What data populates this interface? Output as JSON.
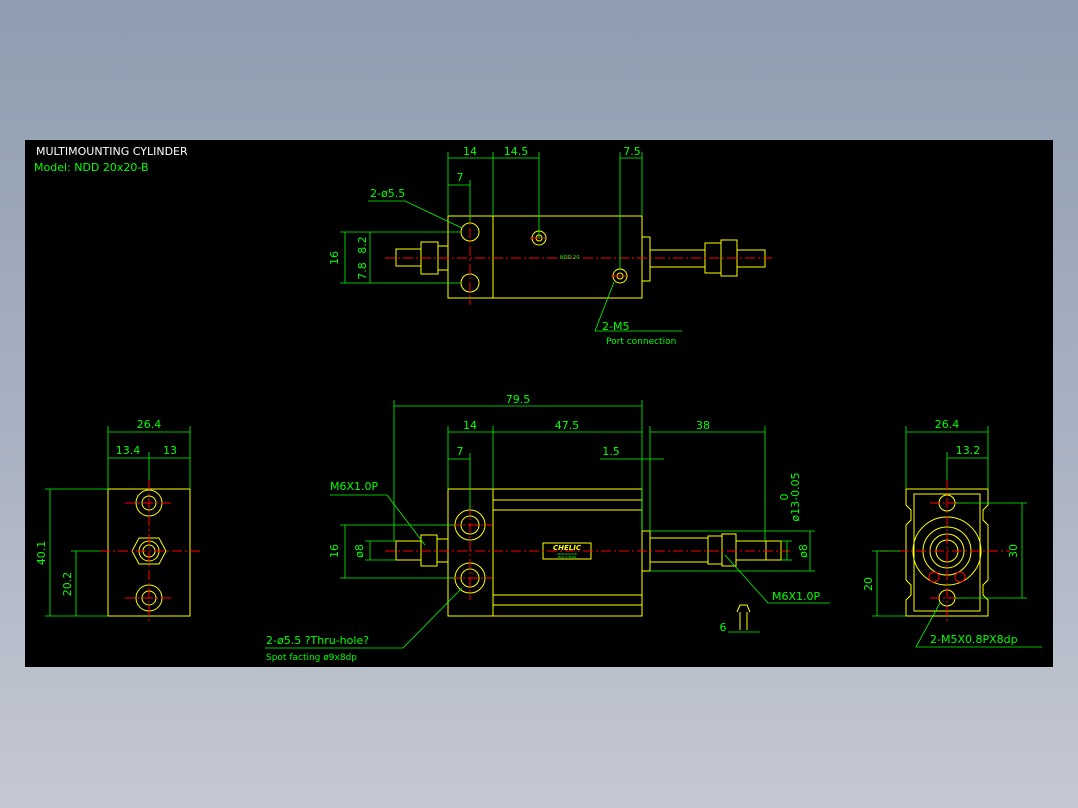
{
  "drawing": {
    "title": "MULTIMOUNTING CYLINDER",
    "model": "Model:  NDD 20x20-B",
    "colors": {
      "background": "#000000",
      "outline": "#ffff00",
      "dimension": "#00ff00",
      "centerline": "#ff0000",
      "title_text": "#ffffff",
      "model_text": "#00ff00",
      "desktop": "#9aa6b8"
    }
  },
  "top_view": {
    "dims": {
      "d14": "14",
      "d14_5": "14.5",
      "d7_5": "7.5",
      "d7": "7",
      "d16": "16",
      "d7_8": "7.8",
      "d8_2": "8.2"
    },
    "callouts": {
      "holes": "2-ø5.5",
      "ports": "2-M5",
      "ports_note": "Port connection",
      "nameplate": "NDD 20"
    }
  },
  "front_view": {
    "dims": {
      "overall": "79.5",
      "d14": "14",
      "d47_5": "47.5",
      "d38": "38",
      "d7": "7",
      "d1_5": "1.5",
      "d16": "16",
      "dia8_left": "ø8",
      "dia8_right": "ø8",
      "rod_dia": "ø13-0.05",
      "rod_tol": "0",
      "wrench": "6"
    },
    "callouts": {
      "thread_left": "M6X1.0P",
      "thread_right": "M6X1.0P",
      "holes": "2-ø5.5 ?Thru-hole?",
      "spot": "Spot facting   ø9x8dp",
      "brand": "CHELIC",
      "label_line1": "NDD20X20-B",
      "label_line2": "MAX 0.9MPa"
    }
  },
  "left_view": {
    "dims": {
      "width": "26.4",
      "a": "13.4",
      "b": "13",
      "height": "40.1",
      "half": "20.2"
    }
  },
  "right_view": {
    "dims": {
      "width": "26.4",
      "half": "13.2",
      "h30": "30",
      "h20": "20"
    },
    "callouts": {
      "thread": "2-M5X0.8PX8dp"
    }
  }
}
